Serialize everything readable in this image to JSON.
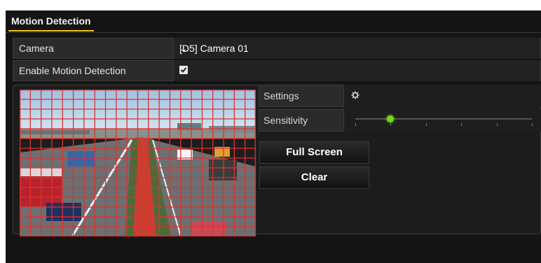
{
  "tab": {
    "label": "Motion Detection"
  },
  "camera": {
    "label": "Camera",
    "value": "[D5] Camera 01"
  },
  "enable": {
    "label": "Enable Motion Detection",
    "checked": true
  },
  "settings": {
    "label": "Settings",
    "icon": "gear-icon"
  },
  "sensitivity": {
    "label": "Sensitivity",
    "level_fraction": 0.2,
    "tick_count": 6
  },
  "buttons": {
    "full_screen": "Full Screen",
    "clear": "Clear"
  },
  "grid": {
    "columns": 22,
    "rows": 15,
    "color": "#e03030"
  },
  "colors": {
    "accent": "#f0c419",
    "panel_bg": "#141414",
    "row_bg": "#2b2b2b",
    "slider_knob": "#7ed321"
  }
}
